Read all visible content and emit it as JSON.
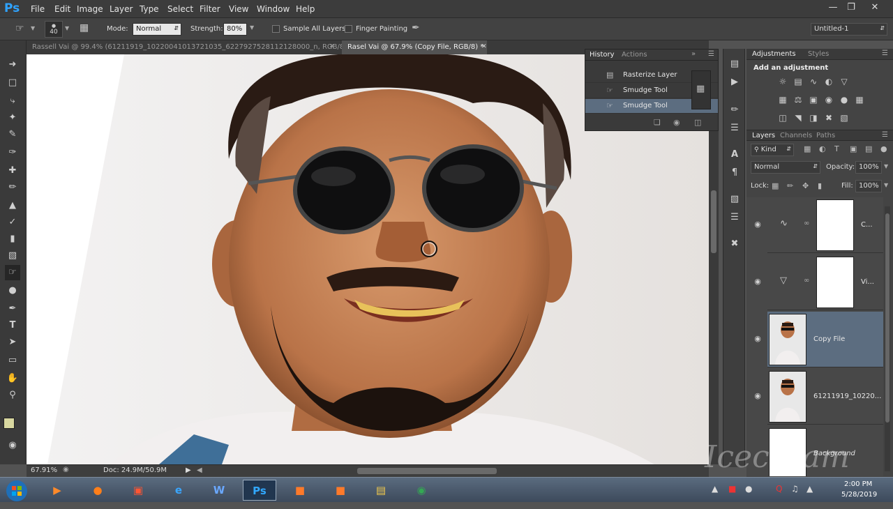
{
  "app": {
    "logo": "Ps",
    "menu": [
      "File",
      "Edit",
      "Image",
      "Layer",
      "Type",
      "Select",
      "Filter",
      "View",
      "Window",
      "Help"
    ],
    "window_controls": [
      "minimize",
      "maximize",
      "close"
    ]
  },
  "options_bar": {
    "brush_size": "40",
    "mode_label": "Mode:",
    "mode_value": "Normal",
    "strength_label": "Strength:",
    "strength_value": "80%",
    "sample_all_layers": "Sample All Layers",
    "finger_painting": "Finger Painting",
    "workspace": "Untitled-1"
  },
  "doc_tabs": [
    {
      "label": "Rassell Vai @ 99.4% (61211919_10220041013721035_6227927528112128000_n, RGB/8) *",
      "active": false
    },
    {
      "label": "Rasel Vai @ 67.9% (Copy File, RGB/8) *",
      "active": true
    }
  ],
  "status_bar": {
    "zoom": "67.91%",
    "doc": "Doc: 24.9M/50.9M"
  },
  "history": {
    "tabs": [
      "History",
      "Actions"
    ],
    "items": [
      "Rasterize Layer",
      "Smudge Tool",
      "Smudge Tool"
    ],
    "selected_index": 2
  },
  "adjustments": {
    "tabs": [
      "Adjustments",
      "Styles"
    ],
    "title": "Add an adjustment"
  },
  "layers": {
    "tabs": [
      "Layers",
      "Channels",
      "Paths"
    ],
    "filter_kind": "Kind",
    "blend_mode": "Normal",
    "opacity_label": "Opacity:",
    "opacity_value": "100%",
    "lock_label": "Lock:",
    "fill_label": "Fill:",
    "fill_value": "100%",
    "items": [
      {
        "name": "C...",
        "selected": false,
        "kind": "curves"
      },
      {
        "name": "Vi...",
        "selected": false,
        "kind": "vibrance"
      },
      {
        "name": "Copy File",
        "selected": true,
        "kind": "photo"
      },
      {
        "name": "61211919_10220...",
        "selected": false,
        "kind": "photo"
      },
      {
        "name": "Background",
        "selected": false,
        "kind": "white"
      }
    ]
  },
  "taskbar": {
    "time": "2:00 PM",
    "date": "5/28/2019"
  },
  "watermark": "Icecream",
  "colors": {
    "accent_blue": "#2fa3ff",
    "selected_layer": "#5c6d80",
    "foreground_swatch": "#d8d7a0",
    "background_swatch": "#ffffff"
  }
}
